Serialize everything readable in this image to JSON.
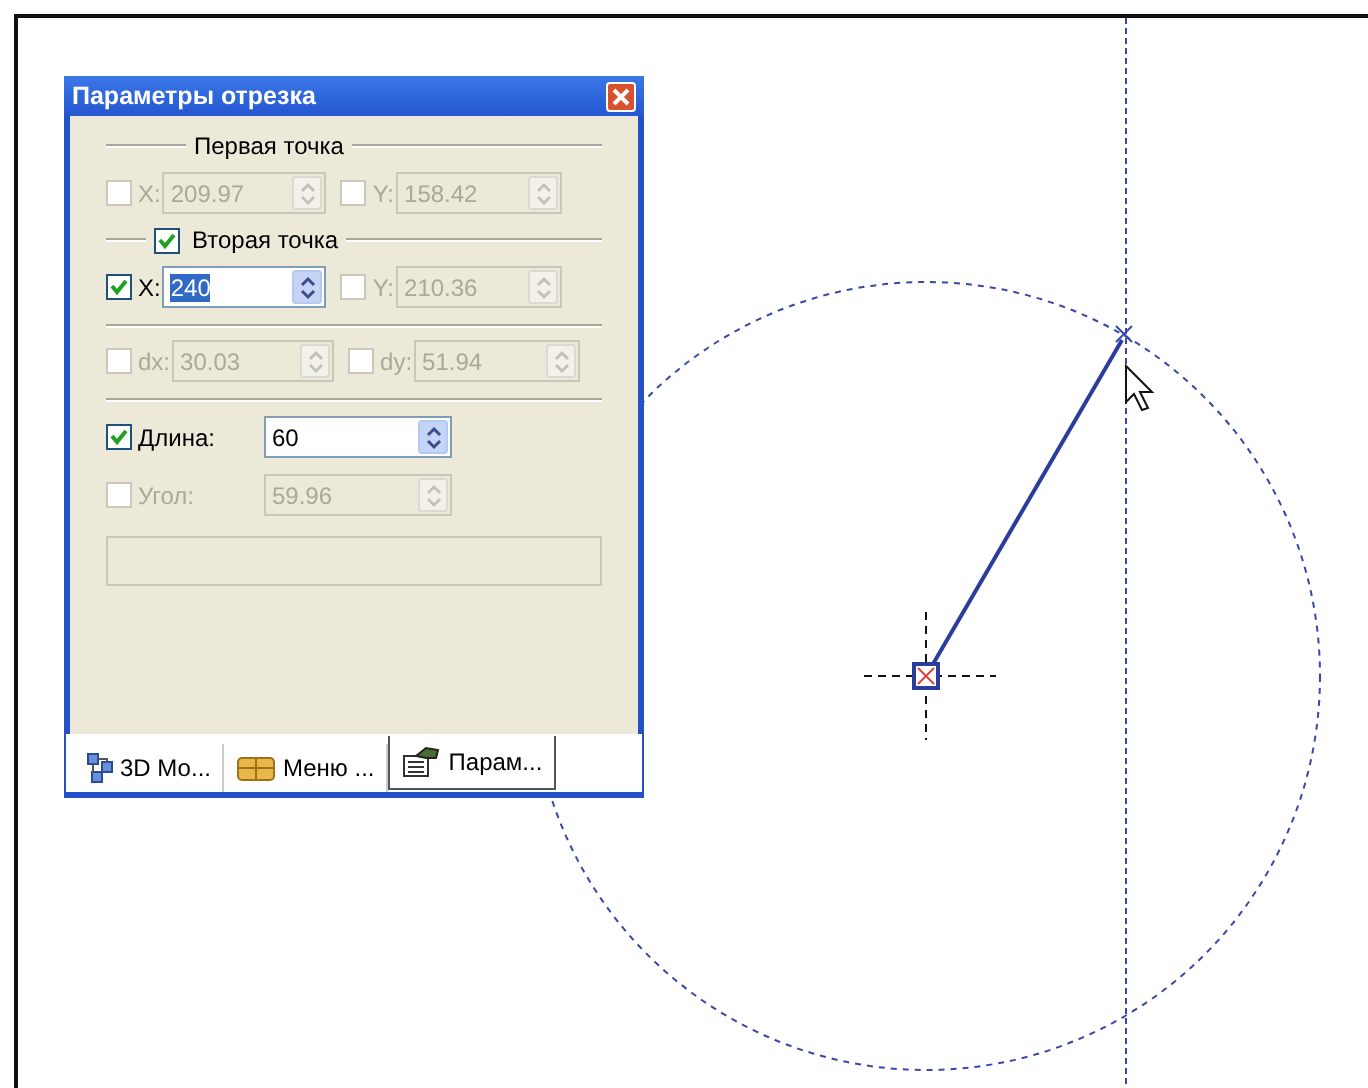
{
  "panel": {
    "title": "Параметры отрезка",
    "rows": [
      {
        "kind": "heading",
        "label": "Первая точка"
      },
      {
        "kind": "pair",
        "fields": [
          {
            "label": "X:",
            "value": "209.97",
            "checked": false,
            "disabled": true,
            "selected": false
          },
          {
            "label": "Y:",
            "value": "158.42",
            "checked": false,
            "disabled": true,
            "selected": false
          }
        ]
      },
      {
        "kind": "check-heading",
        "label": "Вторая точка",
        "checked": true
      },
      {
        "kind": "pair",
        "fields": [
          {
            "label": "X:",
            "value": "240",
            "checked": true,
            "disabled": false,
            "selected": true
          },
          {
            "label": "Y:",
            "value": "210.36",
            "checked": false,
            "disabled": true,
            "selected": false
          }
        ]
      },
      {
        "kind": "rule"
      },
      {
        "kind": "pair",
        "fields": [
          {
            "label": "dx:",
            "value": "30.03",
            "checked": false,
            "disabled": true,
            "selected": false
          },
          {
            "label": "dy:",
            "value": "51.94",
            "checked": false,
            "disabled": true,
            "selected": false
          }
        ]
      },
      {
        "kind": "rule"
      },
      {
        "kind": "single",
        "fields": [
          {
            "label": "Длина:",
            "value": "60",
            "checked": true,
            "disabled": false,
            "selected": false
          }
        ]
      },
      {
        "kind": "single",
        "fields": [
          {
            "label": "Угол:",
            "value": "59.96",
            "checked": false,
            "disabled": true,
            "selected": false
          }
        ]
      },
      {
        "kind": "message-box"
      }
    ],
    "tabs": [
      {
        "kind": "model",
        "label": "3D Мо...",
        "selected": false
      },
      {
        "kind": "menu",
        "label": "Меню ...",
        "selected": false
      },
      {
        "kind": "params",
        "label": "Парам...",
        "selected": true
      }
    ]
  }
}
